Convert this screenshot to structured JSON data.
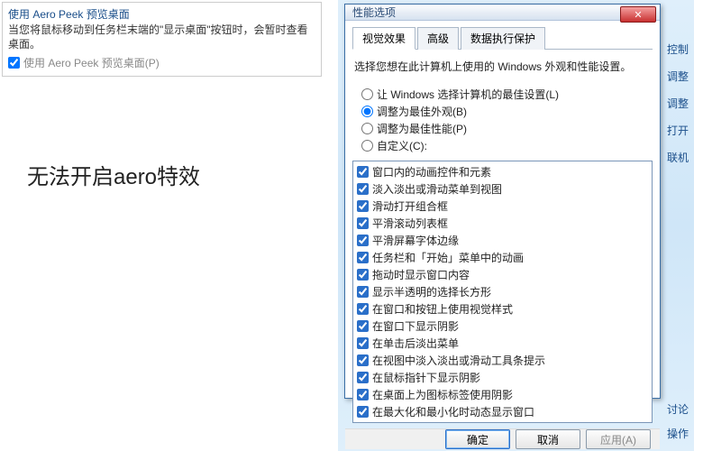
{
  "left_panel": {
    "title": "使用 Aero Peek 预览桌面",
    "desc": "当您将鼠标移动到任务栏末端的\"显示桌面\"按钮时，会暂时查看桌面。",
    "checkbox_label": "使用 Aero Peek 预览桌面(P)",
    "checkbox_checked": true
  },
  "caption": "无法开启aero特效",
  "dialog": {
    "title": "性能选项",
    "tabs": [
      "视觉效果",
      "高级",
      "数据执行保护"
    ],
    "active_tab": 0,
    "instruction": "选择您想在此计算机上使用的 Windows 外观和性能设置。",
    "radios": [
      {
        "label": "让 Windows 选择计算机的最佳设置(L)",
        "checked": false
      },
      {
        "label": "调整为最佳外观(B)",
        "checked": true
      },
      {
        "label": "调整为最佳性能(P)",
        "checked": false
      },
      {
        "label": "自定义(C):",
        "checked": false
      }
    ],
    "options": [
      "窗口内的动画控件和元素",
      "淡入淡出或滑动菜单到视图",
      "滑动打开组合框",
      "平滑滚动列表框",
      "平滑屏幕字体边缘",
      "任务栏和「开始」菜单中的动画",
      "拖动时显示窗口内容",
      "显示半透明的选择长方形",
      "在窗口和按钮上使用视觉样式",
      "在窗口下显示阴影",
      "在单击后淡出菜单",
      "在视图中淡入淡出或滑动工具条提示",
      "在鼠标指针下显示阴影",
      "在桌面上为图标标签使用阴影",
      "在最大化和最小化时动态显示窗口"
    ],
    "buttons": {
      "ok": "确定",
      "cancel": "取消",
      "apply": "应用(A)"
    }
  },
  "side_links": [
    "控制",
    "调整",
    "调整",
    "打开",
    "联机"
  ],
  "side_bottom": [
    "讨论",
    "操作"
  ]
}
